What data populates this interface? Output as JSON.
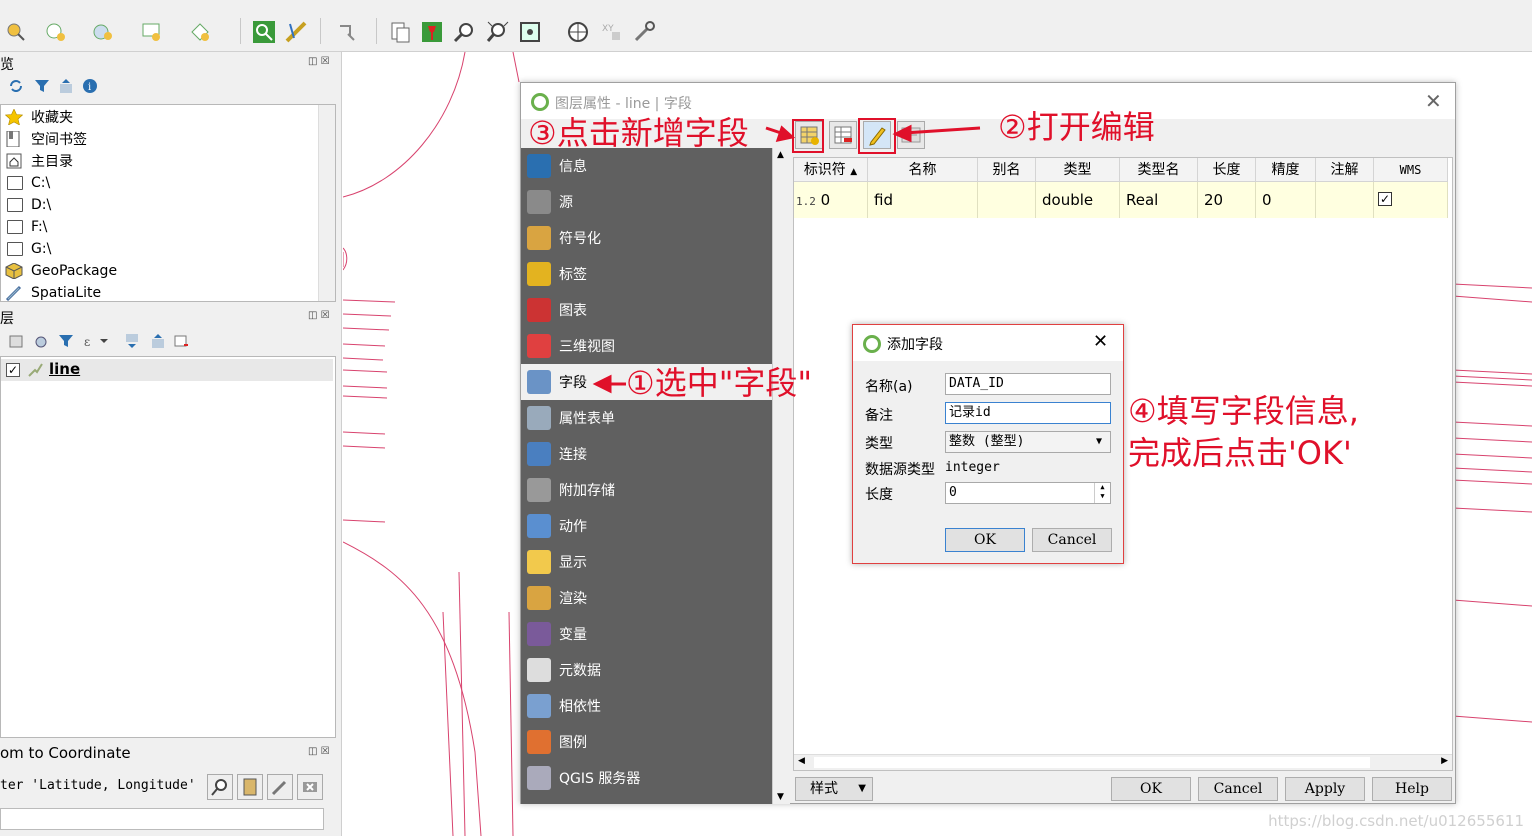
{
  "browser_panel": {
    "title": "览",
    "items": [
      {
        "label": "收藏夹",
        "icon": "star-icon"
      },
      {
        "label": "空间书签",
        "icon": "bookmark-icon"
      },
      {
        "label": "主目录",
        "icon": "home-icon"
      },
      {
        "label": "C:\\",
        "icon": "folder-icon"
      },
      {
        "label": "D:\\",
        "icon": "folder-icon"
      },
      {
        "label": "F:\\",
        "icon": "folder-icon"
      },
      {
        "label": "G:\\",
        "icon": "folder-icon"
      },
      {
        "label": "GeoPackage",
        "icon": "geopackage-icon"
      },
      {
        "label": "SpatiaLite",
        "icon": "spatialite-icon"
      }
    ]
  },
  "layers_panel": {
    "title": "层",
    "layer": {
      "name": "line",
      "checked": true
    }
  },
  "coord_panel": {
    "title": "om to Coordinate",
    "hint": "ter 'Latitude, Longitude'"
  },
  "layer_properties": {
    "window_title": "图层属性 - line | 字段",
    "sidebar": [
      {
        "label": "信息",
        "icon": "info-icon",
        "selected": false
      },
      {
        "label": "源",
        "icon": "source-icon",
        "selected": false
      },
      {
        "label": "符号化",
        "icon": "symbology-icon",
        "selected": false
      },
      {
        "label": "标签",
        "icon": "labels-icon",
        "selected": false
      },
      {
        "label": "图表",
        "icon": "diagrams-icon",
        "selected": false
      },
      {
        "label": "三维视图",
        "icon": "3d-view-icon",
        "selected": false
      },
      {
        "label": "字段",
        "icon": "fields-icon",
        "selected": true
      },
      {
        "label": "属性表单",
        "icon": "attribute-form-icon",
        "selected": false
      },
      {
        "label": "连接",
        "icon": "joins-icon",
        "selected": false
      },
      {
        "label": "附加存储",
        "icon": "auxiliary-storage-icon",
        "selected": false
      },
      {
        "label": "动作",
        "icon": "actions-icon",
        "selected": false
      },
      {
        "label": "显示",
        "icon": "display-icon",
        "selected": false
      },
      {
        "label": "渲染",
        "icon": "rendering-icon",
        "selected": false
      },
      {
        "label": "变量",
        "icon": "variables-icon",
        "selected": false
      },
      {
        "label": "元数据",
        "icon": "metadata-icon",
        "selected": false
      },
      {
        "label": "相依性",
        "icon": "dependencies-icon",
        "selected": false
      },
      {
        "label": "图例",
        "icon": "legend-icon",
        "selected": false
      },
      {
        "label": "QGIS 服务器",
        "icon": "qgis-server-icon",
        "selected": false
      }
    ],
    "table": {
      "headers": [
        "标识符",
        "名称",
        "别名",
        "类型",
        "类型名",
        "长度",
        "精度",
        "注解",
        "WMS"
      ],
      "row": {
        "id_prefix": "1.2",
        "id": "0",
        "name": "fid",
        "alias": "",
        "type": "double",
        "type_name": "Real",
        "length": "20",
        "precision": "0",
        "comment": "",
        "wms": true
      }
    },
    "buttons": {
      "style": "样式",
      "ok": "OK",
      "cancel": "Cancel",
      "apply": "Apply",
      "help": "Help"
    }
  },
  "add_field": {
    "title": "添加字段",
    "name_label": "名称(a)",
    "name_value": "DATA_ID",
    "comment_label": "备注",
    "comment_value": "记录id",
    "type_label": "类型",
    "type_value": "整数 (整型)",
    "provider_type_label": "数据源类型",
    "provider_type_value": "integer",
    "length_label": "长度",
    "length_value": "0",
    "ok": "OK",
    "cancel": "Cancel"
  },
  "annotations": {
    "step1": "①选中\"字段\"",
    "step2": "②打开编辑",
    "step3": "③点击新增字段",
    "step4_line1": "④填写字段信息,",
    "step4_line2": "完成后点击'OK'",
    "color": "#e0102a"
  },
  "watermark": "https://blog.csdn.net/u012655611"
}
